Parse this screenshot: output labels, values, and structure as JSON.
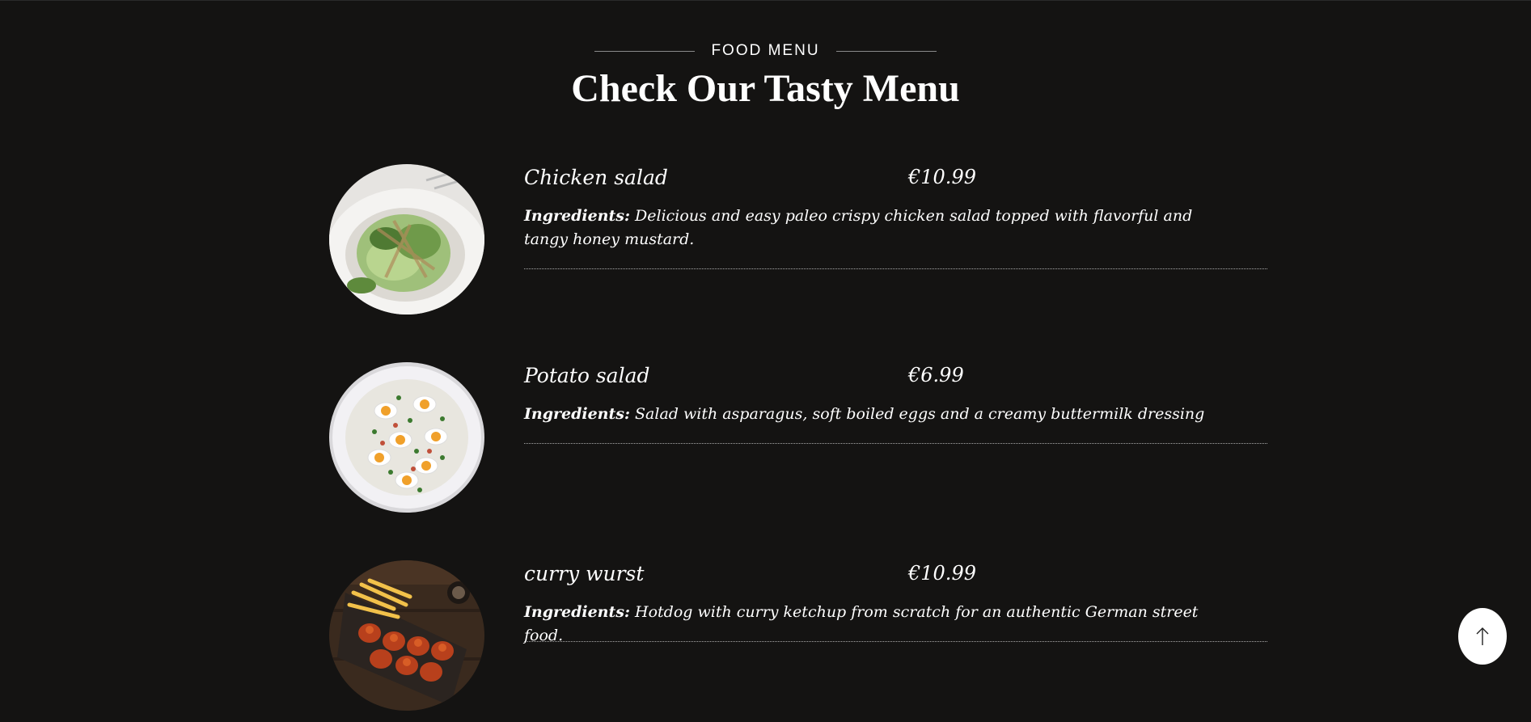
{
  "section": {
    "eyebrow": "FOOD MENU",
    "heading": "Check Our Tasty Menu"
  },
  "menu": {
    "ingredients_label": "Ingredients:",
    "items": [
      {
        "name": "Chicken salad",
        "price": "€10.99",
        "description": "Delicious and easy paleo crispy chicken salad topped with flavorful and tangy honey mustard.",
        "image_icon": "chicken-salad-photo"
      },
      {
        "name": "Potato salad",
        "price": "€6.99",
        "description": "Salad with asparagus, soft boiled eggs and a creamy buttermilk dressing",
        "image_icon": "potato-salad-photo"
      },
      {
        "name": "curry wurst",
        "price": "€10.99",
        "description": "Hotdog with curry ketchup from scratch for an authentic German street food.",
        "image_icon": "currywurst-photo"
      }
    ]
  },
  "back_to_top": {
    "icon": "arrow-up-icon"
  },
  "colors": {
    "background": "#141312",
    "text": "#ffffff",
    "divider": "#a9a9a9"
  }
}
